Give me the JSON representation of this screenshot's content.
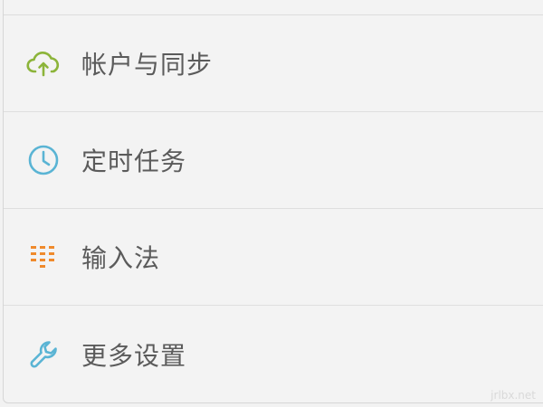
{
  "menu": {
    "items": [
      {
        "label": "帐户与同步",
        "icon": "cloud-upload-icon",
        "color": "#8cb43a"
      },
      {
        "label": "定时任务",
        "icon": "clock-icon",
        "color": "#5ab4d4"
      },
      {
        "label": "输入法",
        "icon": "keyboard-dots-icon",
        "color": "#ef8a2c"
      },
      {
        "label": "更多设置",
        "icon": "wrench-icon",
        "color": "#5ab4d4"
      }
    ]
  },
  "watermark": "jrlbx.net"
}
